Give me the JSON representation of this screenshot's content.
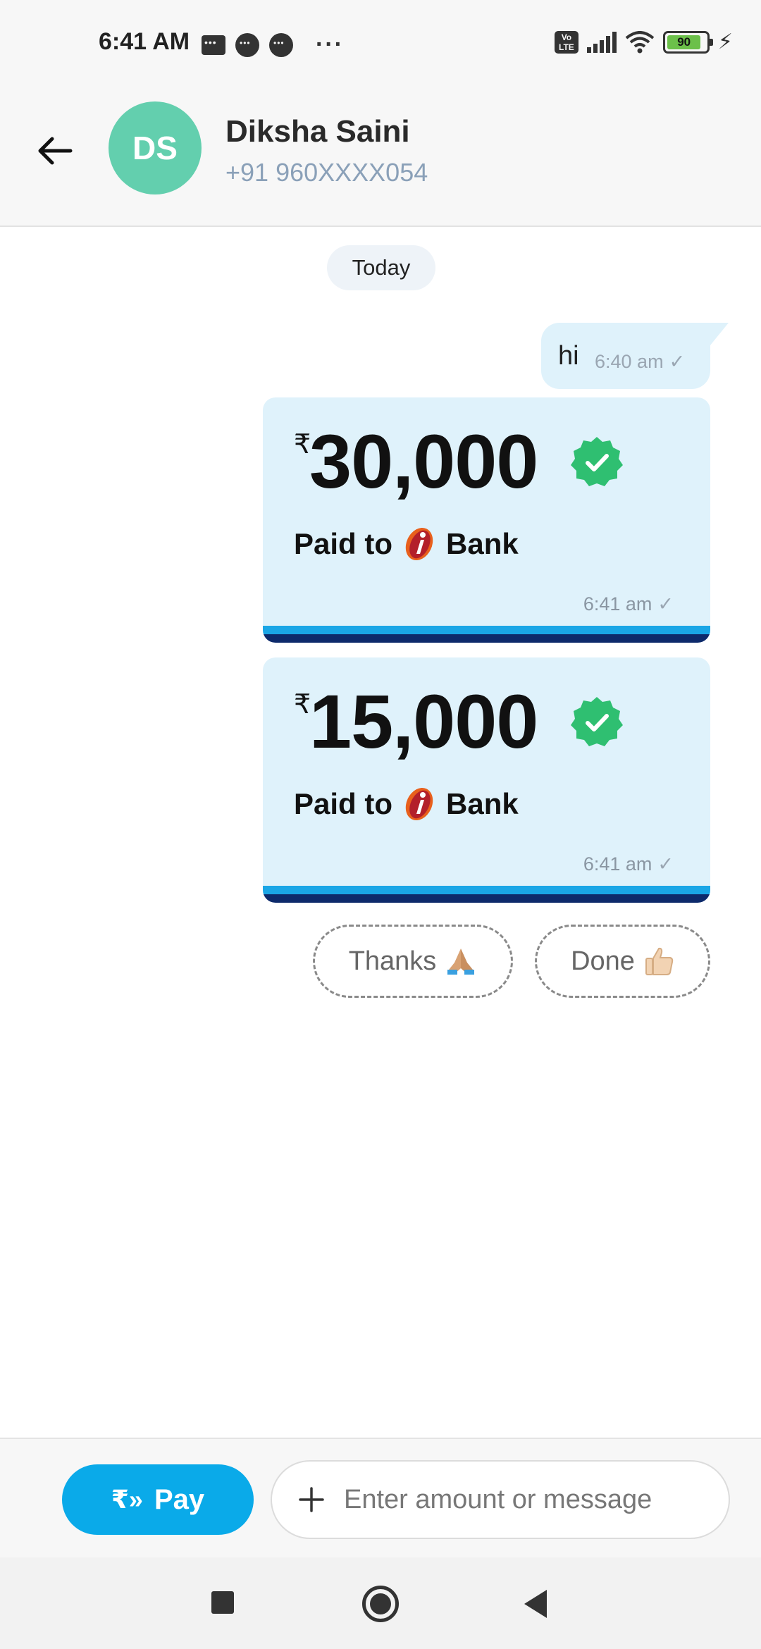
{
  "status_bar": {
    "time": "6:41 AM",
    "battery": "90",
    "icons": [
      "sms-notification-icon",
      "chat-notification-icon",
      "chat-notification-icon",
      "more-notifications-icon",
      "volte-icon",
      "signal-icon",
      "wifi-icon",
      "battery-icon",
      "charging-icon"
    ]
  },
  "header": {
    "avatar_initials": "DS",
    "avatar_color": "#63cfae",
    "name": "Diksha Saini",
    "phone": "+91 960XXXX054"
  },
  "chat": {
    "date_label": "Today",
    "message": {
      "text": "hi",
      "time": "6:40 am"
    },
    "payments": [
      {
        "currency": "₹",
        "amount": "30,000",
        "paid_to": "Paid to",
        "bank": "Bank",
        "time": "6:41 am"
      },
      {
        "currency": "₹",
        "amount": "15,000",
        "paid_to": "Paid to",
        "bank": "Bank",
        "time": "6:41 am"
      }
    ],
    "quick_replies": [
      {
        "label": "Thanks",
        "emoji": "folded-hands-icon"
      },
      {
        "label": "Done",
        "emoji": "thumbs-up-icon"
      }
    ]
  },
  "composer": {
    "pay_label": "Pay",
    "placeholder": "Enter amount or message"
  },
  "colors": {
    "accent": "#0aaae9",
    "bubble": "#dff2fb",
    "verified": "#2fbf71"
  }
}
